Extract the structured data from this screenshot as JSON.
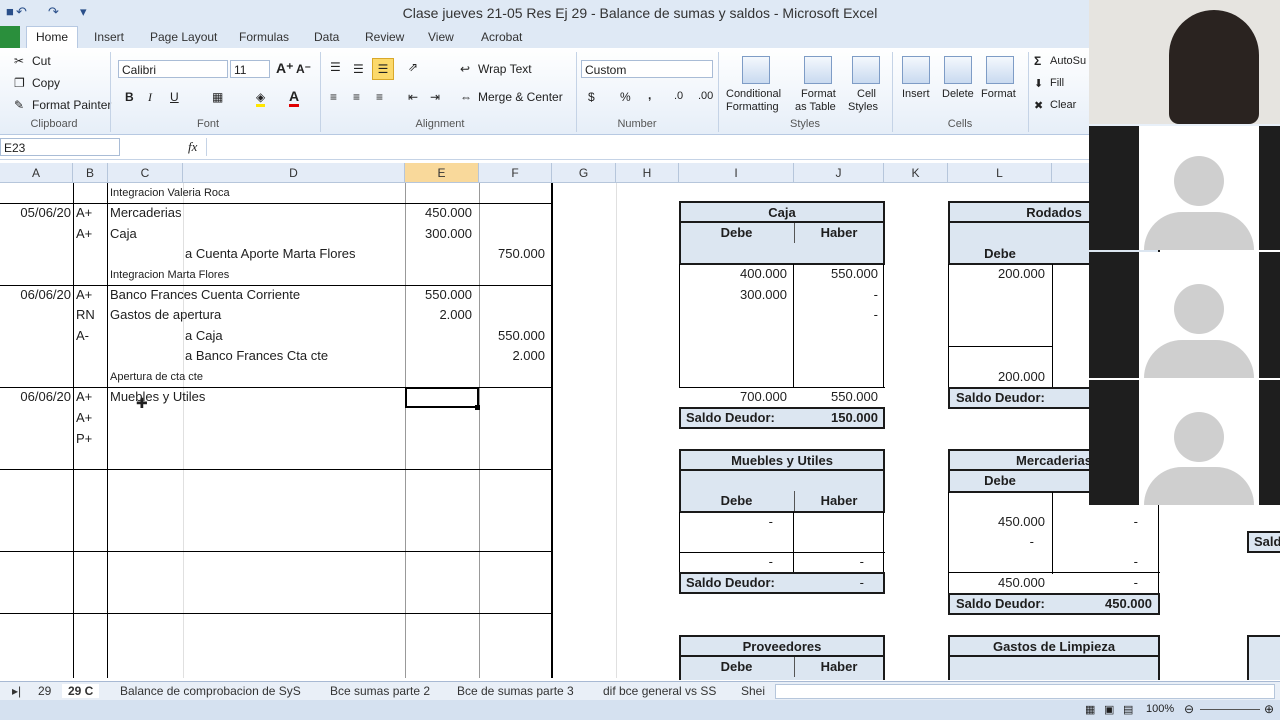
{
  "window": {
    "title": "Clase jueves 21-05 Res Ej 29 - Balance de sumas y saldos  -  Microsoft Excel"
  },
  "ribbon_tabs": [
    "Home",
    "Insert",
    "Page Layout",
    "Formulas",
    "Data",
    "Review",
    "View",
    "Acrobat"
  ],
  "clipboard": {
    "cut": "Cut",
    "copy": "Copy",
    "format_painter": "Format Painter",
    "group": "Clipboard"
  },
  "font": {
    "name": "Calibri",
    "size": "11",
    "group": "Font"
  },
  "alignment": {
    "wrap": "Wrap Text",
    "merge": "Merge & Center",
    "group": "Alignment"
  },
  "number": {
    "format": "Custom",
    "group": "Number"
  },
  "styles": {
    "conditional": "Conditional",
    "conditional2": "Formatting",
    "format_table": "Format",
    "format_table2": "as Table",
    "cell_styles": "Cell",
    "cell_styles2": "Styles",
    "group": "Styles"
  },
  "cells": {
    "insert": "Insert",
    "delete": "Delete",
    "format": "Format",
    "group": "Cells"
  },
  "editing": {
    "autosum": "AutoSu",
    "fill": "Fill",
    "clear": "Clear"
  },
  "formula_bar": {
    "name_box": "E23",
    "fx": "fx"
  },
  "columns": [
    "A",
    "B",
    "C",
    "D",
    "E",
    "F",
    "G",
    "H",
    "I",
    "J",
    "K",
    "L"
  ],
  "journal": [
    {
      "c": "Integracion Valeria Roca"
    },
    {
      "a": "05/06/20",
      "b": "A+",
      "c": "Mercaderias",
      "e": "450.000"
    },
    {
      "b": "A+",
      "c": "Caja",
      "e": "300.000"
    },
    {
      "d": "a Cuenta Aporte Marta Flores",
      "f": "750.000"
    },
    {
      "c": "Integracion Marta Flores"
    },
    {
      "a": "06/06/20",
      "b": "A+",
      "c": "Banco Frances Cuenta Corriente",
      "e": "550.000"
    },
    {
      "b": "RN",
      "c": "Gastos de apertura",
      "e": "2.000"
    },
    {
      "b": "A-",
      "d": "a Caja",
      "f": "550.000"
    },
    {
      "d": "a Banco Frances Cta cte",
      "f": "2.000"
    },
    {
      "c": "Apertura de cta cte"
    },
    {
      "a": "06/06/20",
      "b": "A+",
      "c": "Muebles y Utiles"
    },
    {
      "b": "A+"
    },
    {
      "b": "P+"
    }
  ],
  "t_accounts": {
    "caja": {
      "title": "Caja",
      "debe": "Debe",
      "haber": "Haber",
      "d1": "400.000",
      "h1": "550.000",
      "d2": "300.000",
      "h2": "-",
      "h3": "-",
      "td": "700.000",
      "th": "550.000",
      "saldo_label": "Saldo Deudor:",
      "saldo": "150.000"
    },
    "rodados": {
      "title": "Rodados",
      "debe": "Debe",
      "d1": "200.000",
      "td": "200.000",
      "saldo_label": "Saldo Deudor:"
    },
    "muebles": {
      "title": "Muebles y Utiles",
      "debe": "Debe",
      "haber": "Haber",
      "d1": "-",
      "td": "-",
      "th": "-",
      "saldo_label": "Saldo Deudor:",
      "saldo": "-"
    },
    "mercaderias": {
      "title": "Mercaderias",
      "debe": "Debe",
      "d1": "450.000",
      "h1": "-",
      "d2": "-",
      "h3": "-",
      "td": "450.000",
      "th": "-",
      "saldo_label": "Saldo Deudor:",
      "saldo": "450.000",
      "extra": "Sald"
    },
    "proveedores": {
      "title": "Proveedores",
      "debe": "Debe",
      "haber": "Haber"
    },
    "gastos_limpieza": {
      "title": "Gastos de Limpieza"
    }
  },
  "sheet_tabs": [
    "29",
    "29 C",
    "Balance de comprobacion de SyS",
    "Bce sumas parte 2",
    "Bce de sumas parte 3",
    "dif bce general vs SS",
    "Shei"
  ],
  "status": {
    "zoom": "100%"
  }
}
